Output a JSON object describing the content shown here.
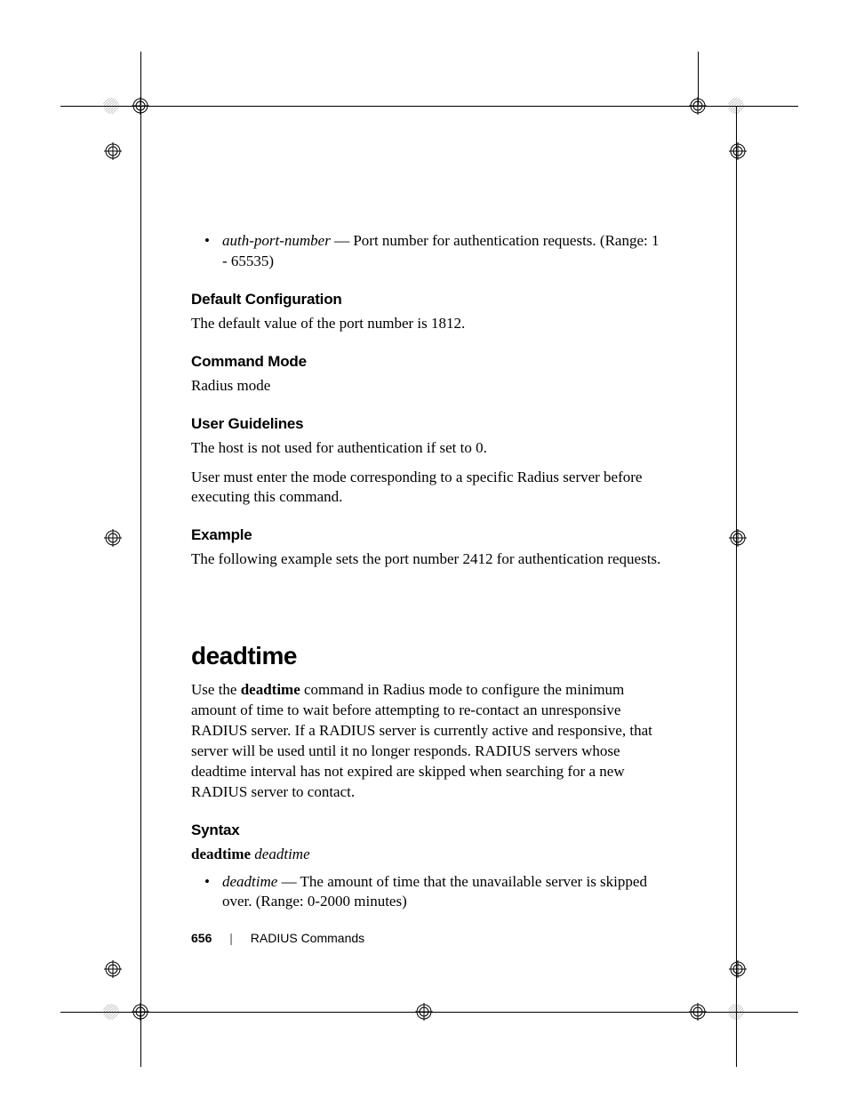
{
  "top_bullet": {
    "term": "auth-port-number",
    "sep": " — ",
    "desc": "Port number for authentication requests. (Range: 1 - 65535)"
  },
  "default_config": {
    "heading": "Default Configuration",
    "text": "The default value of the port number is 1812."
  },
  "command_mode": {
    "heading": "Command Mode",
    "text": "Radius mode"
  },
  "user_guidelines": {
    "heading": "User Guidelines",
    "text1": "The host is not used for authentication if set to 0.",
    "text2": "User must enter the mode corresponding to a specific Radius server before executing this command."
  },
  "example": {
    "heading": "Example",
    "text": "The following example sets the port number 2412 for authentication requests."
  },
  "deadtime": {
    "heading": "deadtime",
    "intro_pre": "Use the ",
    "intro_bold": "deadtime",
    "intro_post": " command in Radius mode to configure the minimum amount of time to wait before attempting to re-contact an unresponsive RADIUS server. If a RADIUS server is currently active and responsive, that server will be used until it no longer responds. RADIUS servers whose deadtime interval has not expired are skipped when searching for a new RADIUS server to contact."
  },
  "syntax": {
    "heading": "Syntax",
    "line_bold": "deadtime",
    "line_space": " ",
    "line_italic": "deadtime",
    "bullet_term": "deadtime",
    "bullet_sep": " — ",
    "bullet_desc": "The amount of time that the unavailable server is skipped over. (Range: 0-2000 minutes)"
  },
  "footer": {
    "page_number": "656",
    "section": "RADIUS Commands"
  }
}
